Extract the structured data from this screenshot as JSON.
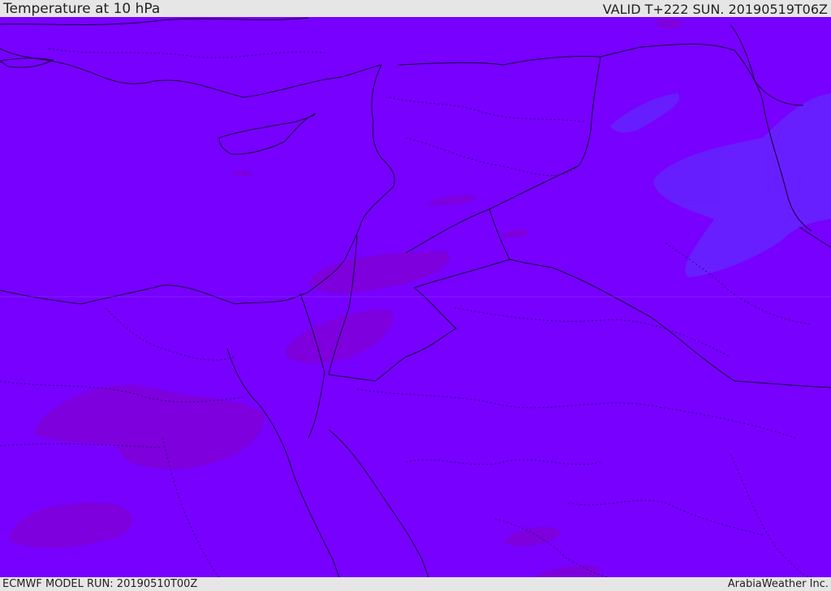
{
  "header": {
    "title": "Temperature at 10 hPa",
    "valid": "VALID T+222 SUN. 20190519T06Z"
  },
  "footer": {
    "model_run": "ECMWF MODEL RUN: 20190510T00Z",
    "credit": "ArabiaWeather Inc."
  },
  "colors": {
    "background_field": "#7700ff",
    "warm_patch": "#7f00d8",
    "cool_patch": "#6622ff",
    "coastline": "#1a0040",
    "border": "#14003a"
  }
}
